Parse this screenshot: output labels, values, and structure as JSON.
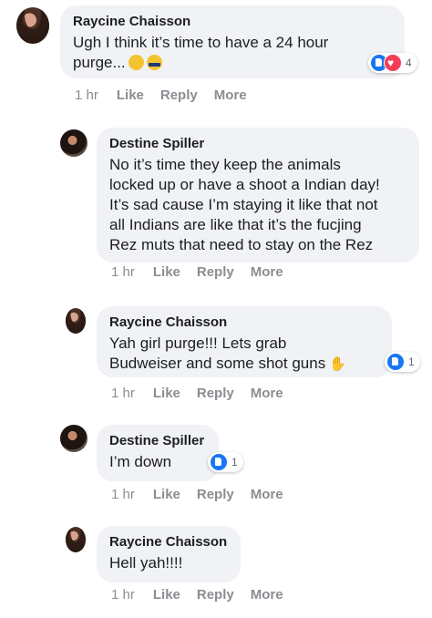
{
  "comments": [
    {
      "author": "Raycine Chaisson",
      "text_lines": [
        "Ugh I think it’s time to have a 24 hour",
        "purge..."
      ],
      "emojis": [
        "persevering-face-emoji",
        "swat-face-emoji"
      ],
      "reactions": {
        "types": [
          "like",
          "love"
        ],
        "count": "4"
      },
      "time": "1 hr",
      "like": "Like",
      "reply": "Reply",
      "more": "More"
    },
    {
      "author": "Destine Spiller",
      "text_lines": [
        "No it’s time they keep the animals",
        "locked up or have a shoot a Indian day!",
        "It’s sad cause I’m staying it like that not",
        "all Indians are like that it’s the fucjing",
        "Rez muts that need to stay on the Rez"
      ],
      "time": "1 hr",
      "like": "Like",
      "reply": "Reply",
      "more": "More"
    },
    {
      "author": "Raycine Chaisson",
      "text_lines": [
        "Yah girl purge!!! Lets grab",
        "Budweiser and some shot guns"
      ],
      "emojis": [
        "ok-hand-emoji"
      ],
      "reactions": {
        "types": [
          "like"
        ],
        "count": "1"
      },
      "time": "1 hr",
      "like": "Like",
      "reply": "Reply",
      "more": "More"
    },
    {
      "author": "Destine Spiller",
      "text_lines": [
        "I’m down"
      ],
      "reactions": {
        "types": [
          "like"
        ],
        "count": "1"
      },
      "time": "1 hr",
      "like": "Like",
      "reply": "Reply",
      "more": "More"
    },
    {
      "author": "Raycine Chaisson",
      "text_lines": [
        "Hell yah!!!!"
      ],
      "time": "1 hr",
      "like": "Like",
      "reply": "Reply",
      "more": "More"
    }
  ]
}
